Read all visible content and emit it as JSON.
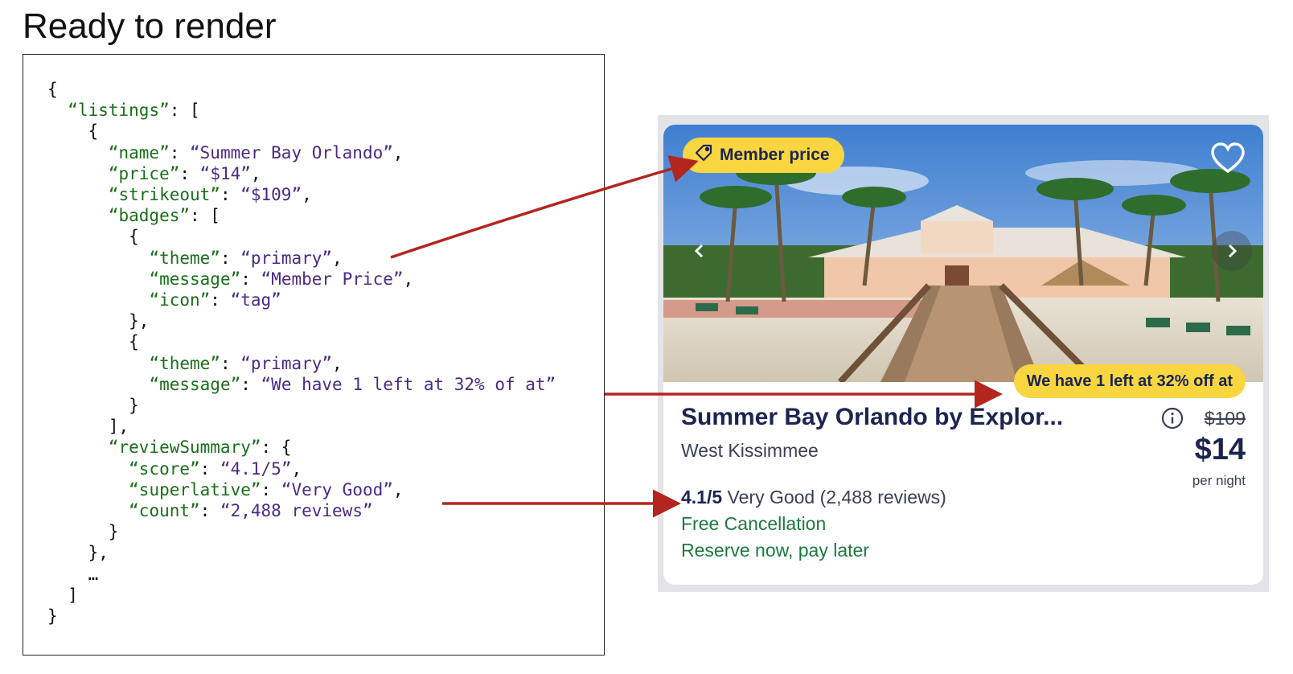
{
  "heading": "Ready to render",
  "code_lines": [
    [
      [
        "p",
        "{"
      ]
    ],
    [
      [
        "p",
        "  "
      ],
      [
        "k",
        "“listings”"
      ],
      [
        "p",
        ": ["
      ]
    ],
    [
      [
        "p",
        "    {"
      ]
    ],
    [
      [
        "p",
        "      "
      ],
      [
        "k",
        "“name”"
      ],
      [
        "p",
        ": "
      ],
      [
        "v",
        "“Summer Bay Orlando”"
      ],
      [
        "p",
        ","
      ]
    ],
    [
      [
        "p",
        "      "
      ],
      [
        "k",
        "“price”"
      ],
      [
        "p",
        ": "
      ],
      [
        "v",
        "“$14”"
      ],
      [
        "p",
        ","
      ]
    ],
    [
      [
        "p",
        "      "
      ],
      [
        "k",
        "“strikeout”"
      ],
      [
        "p",
        ": "
      ],
      [
        "v",
        "“$109”"
      ],
      [
        "p",
        ","
      ]
    ],
    [
      [
        "p",
        "      "
      ],
      [
        "k",
        "“badges”"
      ],
      [
        "p",
        ": ["
      ]
    ],
    [
      [
        "p",
        "        {"
      ]
    ],
    [
      [
        "p",
        "          "
      ],
      [
        "k",
        "“theme”"
      ],
      [
        "p",
        ": "
      ],
      [
        "v",
        "“primary”"
      ],
      [
        "p",
        ","
      ]
    ],
    [
      [
        "p",
        "          "
      ],
      [
        "k",
        "“message”"
      ],
      [
        "p",
        ": "
      ],
      [
        "v",
        "“Member Price”"
      ],
      [
        "p",
        ","
      ]
    ],
    [
      [
        "p",
        "          "
      ],
      [
        "k",
        "“icon”"
      ],
      [
        "p",
        ": "
      ],
      [
        "v",
        "“tag”"
      ]
    ],
    [
      [
        "p",
        "        },"
      ]
    ],
    [
      [
        "p",
        "        {"
      ]
    ],
    [
      [
        "p",
        "          "
      ],
      [
        "k",
        "“theme”"
      ],
      [
        "p",
        ": "
      ],
      [
        "v",
        "“primary”"
      ],
      [
        "p",
        ","
      ]
    ],
    [
      [
        "p",
        "          "
      ],
      [
        "k",
        "“message”"
      ],
      [
        "p",
        ": "
      ],
      [
        "v",
        "“We have 1 left at 32% of at”"
      ]
    ],
    [
      [
        "p",
        "        }"
      ]
    ],
    [
      [
        "p",
        "      ],"
      ]
    ],
    [
      [
        "p",
        "      "
      ],
      [
        "k",
        "“reviewSummary”"
      ],
      [
        "p",
        ": {"
      ]
    ],
    [
      [
        "p",
        "        "
      ],
      [
        "k",
        "“score”"
      ],
      [
        "p",
        ": "
      ],
      [
        "v",
        "“4.1/5”"
      ],
      [
        "p",
        ","
      ]
    ],
    [
      [
        "p",
        "        "
      ],
      [
        "k",
        "“superlative”"
      ],
      [
        "p",
        ": "
      ],
      [
        "v",
        "“Very Good”"
      ],
      [
        "p",
        ","
      ]
    ],
    [
      [
        "p",
        "        "
      ],
      [
        "k",
        "“count”"
      ],
      [
        "p",
        ": "
      ],
      [
        "v",
        "“2,488 reviews”"
      ]
    ],
    [
      [
        "p",
        "      }"
      ]
    ],
    [
      [
        "p",
        "    },"
      ]
    ],
    [
      [
        "p",
        "    …"
      ]
    ],
    [
      [
        "p",
        "  ]"
      ]
    ],
    [
      [
        "p",
        "}"
      ]
    ]
  ],
  "card": {
    "member_badge": "Member price",
    "urgency_badge": "We have 1 left at 32% off at",
    "name": "Summer Bay Orlando by Explor...",
    "location": "West Kissimmee",
    "strikeout": "$109",
    "price": "$14",
    "per_night": "per night",
    "review_score": "4.1/5",
    "review_text": "Very Good (2,488 reviews)",
    "free_cancellation": "Free Cancellation",
    "reserve": "Reserve now, pay later"
  },
  "icons": {
    "member_badge": "tag-icon",
    "favorite": "heart-icon",
    "prev": "chevron-left-icon",
    "next": "chevron-right-icon",
    "info": "info-icon"
  },
  "colors": {
    "badge_yellow": "#f9d640",
    "navy": "#1c2451",
    "green": "#1d7a3f",
    "arrow_red": "#b3261e",
    "json_key": "#1a6e1a",
    "json_value": "#4b2a85"
  }
}
